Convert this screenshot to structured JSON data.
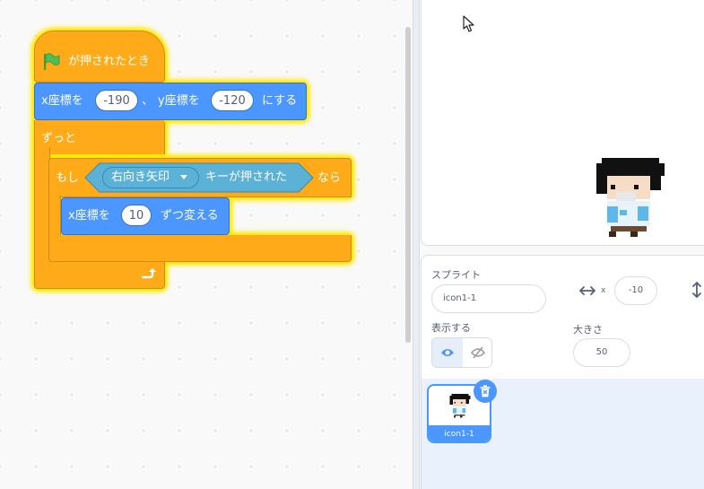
{
  "script": {
    "hat_label": "が押されたとき",
    "goto": {
      "x_label": "x座標を",
      "x_value": "-190",
      "sep": "、",
      "y_label": "y座標を",
      "y_value": "-120",
      "suffix": "にする"
    },
    "forever_label": "ずっと",
    "if_block": {
      "if_label": "もし",
      "key_option": "右向き矢印",
      "sensing_label": "キーが押された",
      "then_label": "なら"
    },
    "change_x": {
      "label": "x座標を",
      "value": "10",
      "suffix": "ずつ変える"
    }
  },
  "sprite_info": {
    "sprite_label": "スプライト",
    "sprite_name": "icon1-1",
    "x_axis_label": "x",
    "x_value": "-10",
    "show_label": "表示する",
    "size_label": "大きさ",
    "size_value": "50"
  },
  "sprite_list": {
    "items": [
      {
        "name": "icon1-1"
      }
    ]
  },
  "colors": {
    "control": "#ffab19",
    "motion": "#4c97ff",
    "sensing": "#5cb1d6",
    "glow": "#ffe800",
    "selected": "#4c97ff"
  },
  "icons": [
    "green-flag-icon",
    "dropdown-arrow-icon",
    "loop-arrow-icon",
    "mouse-cursor-icon",
    "horizontal-arrows-icon",
    "vertical-arrows-icon",
    "eye-icon",
    "eye-slash-icon",
    "trash-icon"
  ]
}
